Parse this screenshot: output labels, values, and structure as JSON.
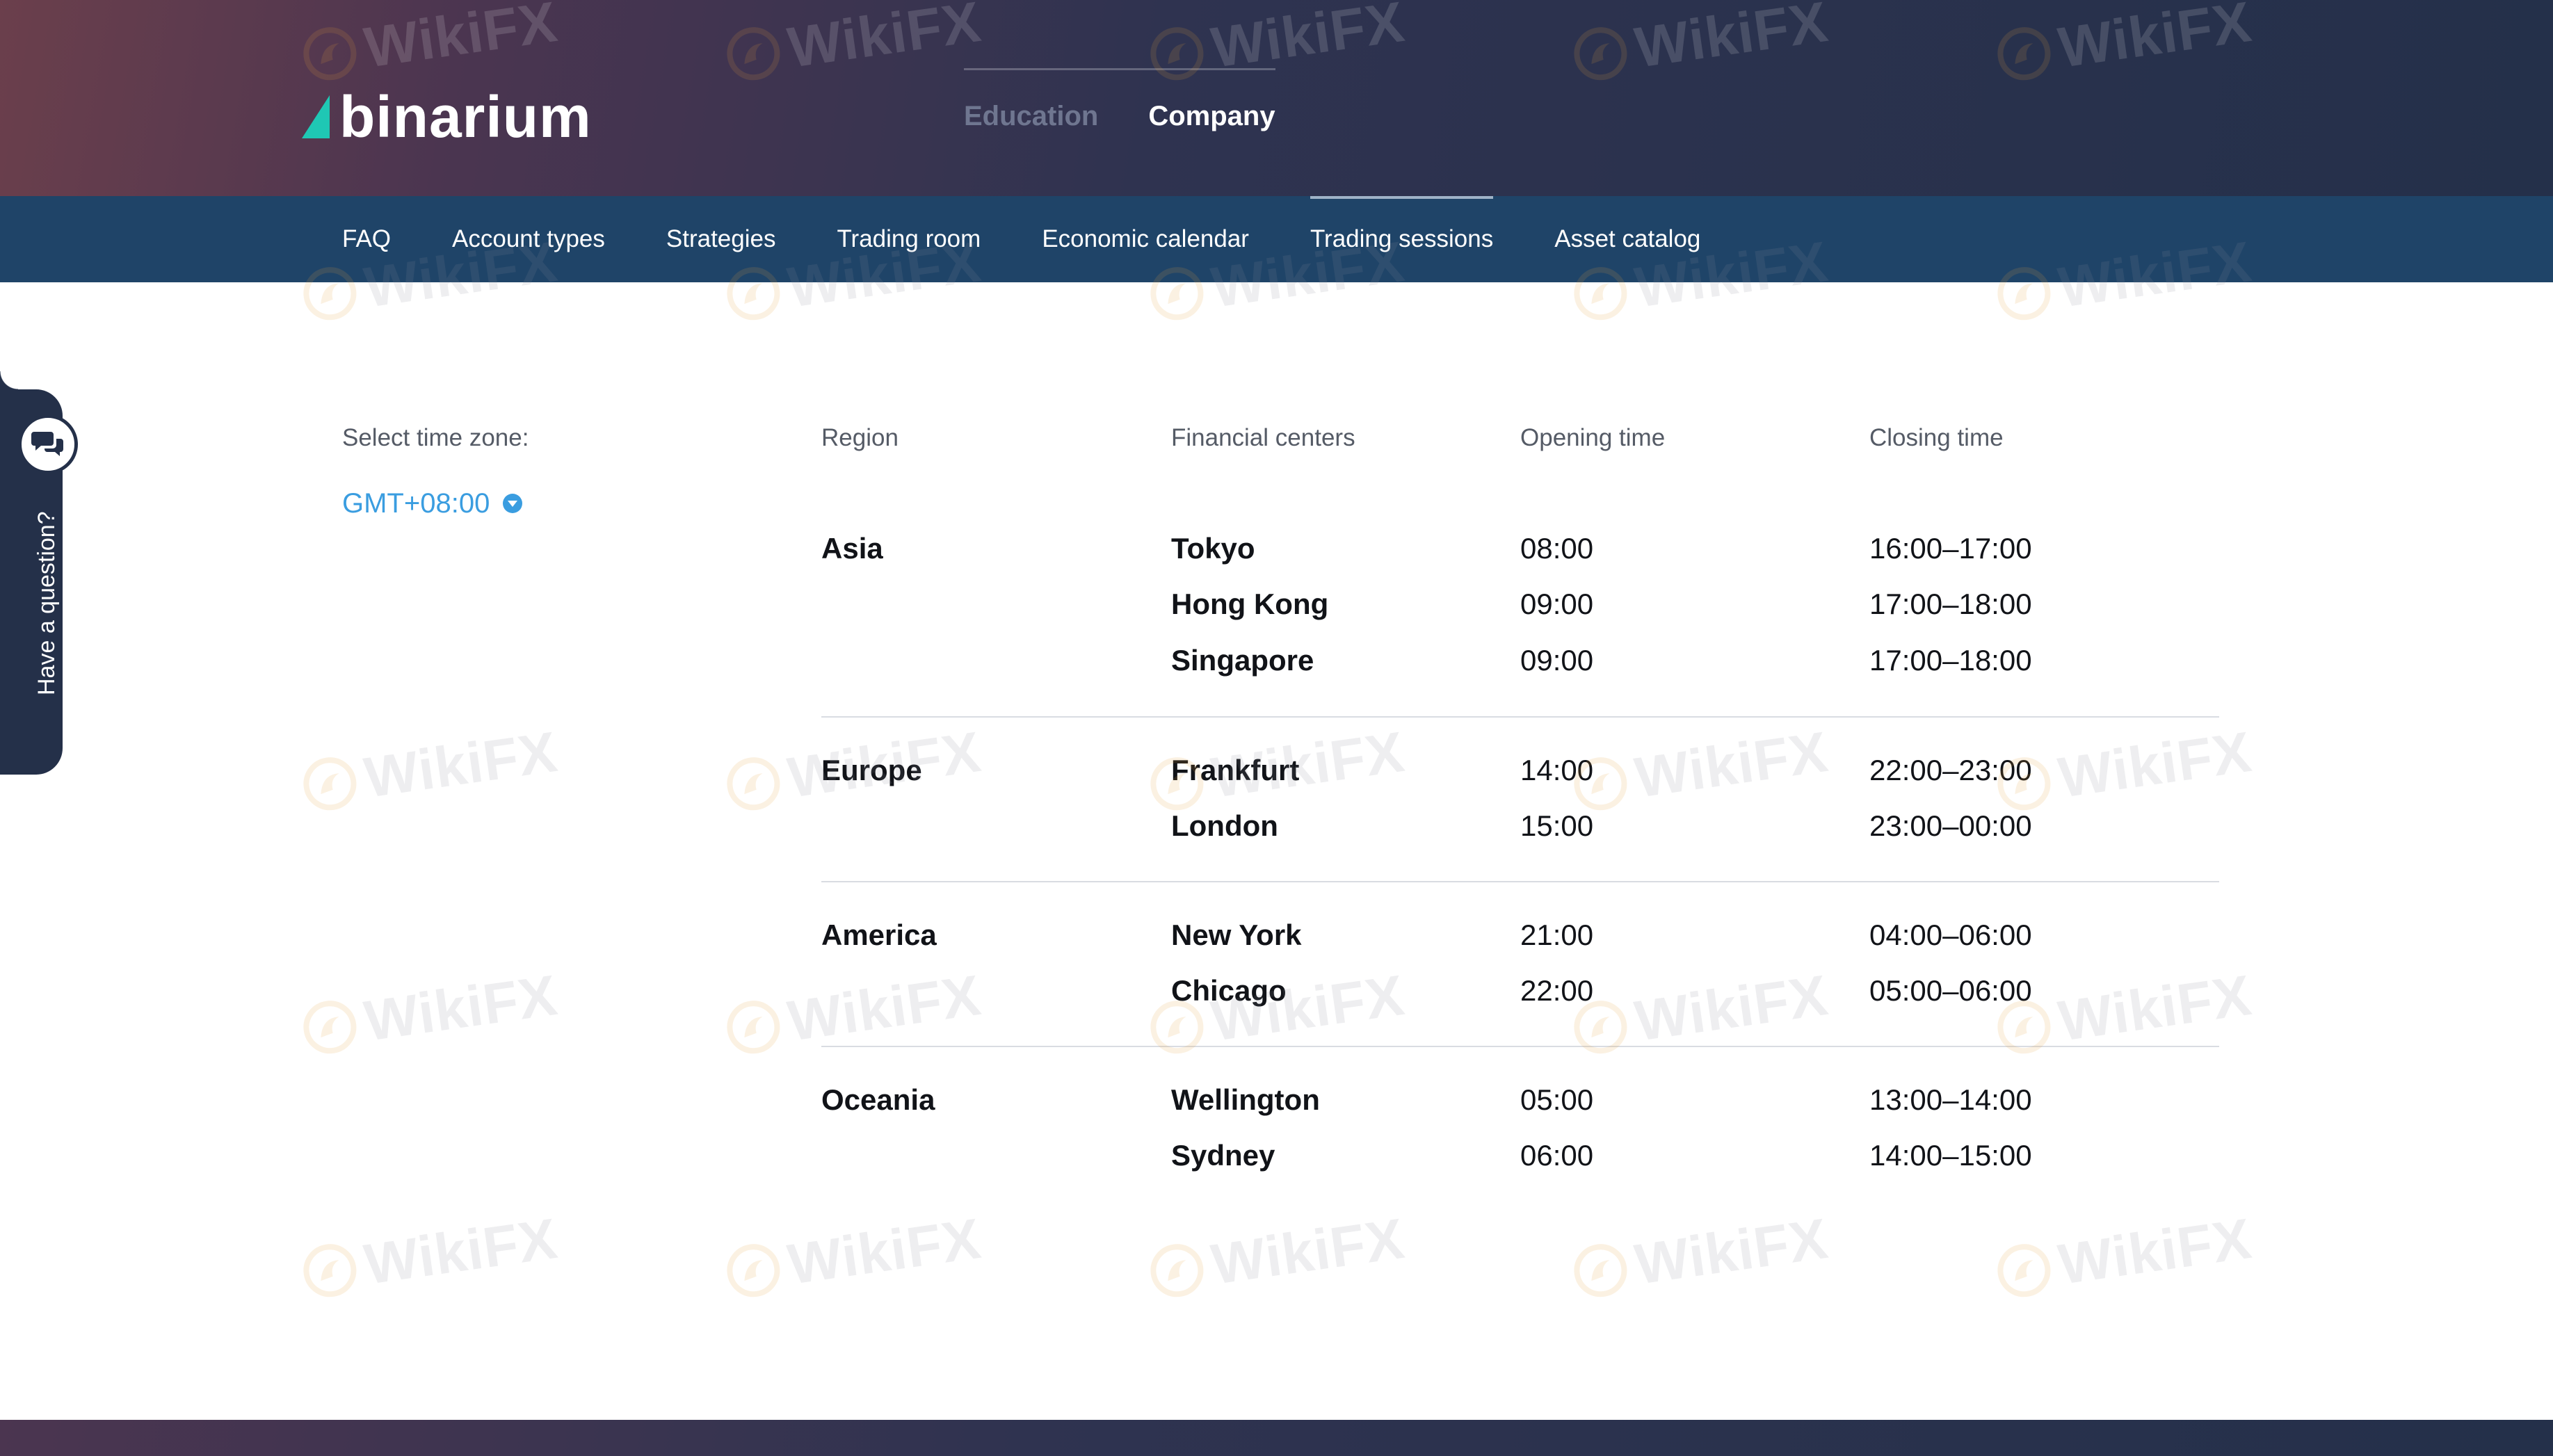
{
  "brand": {
    "name": "binarium",
    "accent_color": "#1fc7b4"
  },
  "top_nav": {
    "items": [
      {
        "label": "Education",
        "active": false
      },
      {
        "label": "Company",
        "active": true
      }
    ]
  },
  "sub_nav": {
    "items": [
      {
        "label": "FAQ",
        "active": false
      },
      {
        "label": "Account types",
        "active": false
      },
      {
        "label": "Strategies",
        "active": false
      },
      {
        "label": "Trading room",
        "active": false
      },
      {
        "label": "Economic calendar",
        "active": false
      },
      {
        "label": "Trading sessions",
        "active": true
      },
      {
        "label": "Asset catalog",
        "active": false
      }
    ]
  },
  "side_tab": {
    "label": "Have a question?",
    "icon": "chat-bubbles-icon"
  },
  "timezone": {
    "label": "Select time zone:",
    "value": "GMT+08:00",
    "icon": "chevron-down-circle-icon",
    "color": "#3a9de0"
  },
  "table": {
    "headers": {
      "region": "Region",
      "centers": "Financial centers",
      "opening": "Opening time",
      "closing": "Closing time"
    },
    "regions": [
      {
        "name": "Asia",
        "rows": [
          {
            "center": "Tokyo",
            "opening": "08:00",
            "closing": "16:00–17:00"
          },
          {
            "center": "Hong Kong",
            "opening": "09:00",
            "closing": "17:00–18:00"
          },
          {
            "center": "Singapore",
            "opening": "09:00",
            "closing": "17:00–18:00"
          }
        ]
      },
      {
        "name": "Europe",
        "rows": [
          {
            "center": "Frankfurt",
            "opening": "14:00",
            "closing": "22:00–23:00"
          },
          {
            "center": "London",
            "opening": "15:00",
            "closing": "23:00–00:00"
          }
        ]
      },
      {
        "name": "America",
        "rows": [
          {
            "center": "New York",
            "opening": "21:00",
            "closing": "04:00–06:00"
          },
          {
            "center": "Chicago",
            "opening": "22:00",
            "closing": "05:00–06:00"
          }
        ]
      },
      {
        "name": "Oceania",
        "rows": [
          {
            "center": "Wellington",
            "opening": "05:00",
            "closing": "13:00–14:00"
          },
          {
            "center": "Sydney",
            "opening": "06:00",
            "closing": "14:00–15:00"
          }
        ]
      }
    ]
  },
  "watermark": {
    "text": "WikiFX",
    "icon": "wikifx-logo-icon"
  }
}
